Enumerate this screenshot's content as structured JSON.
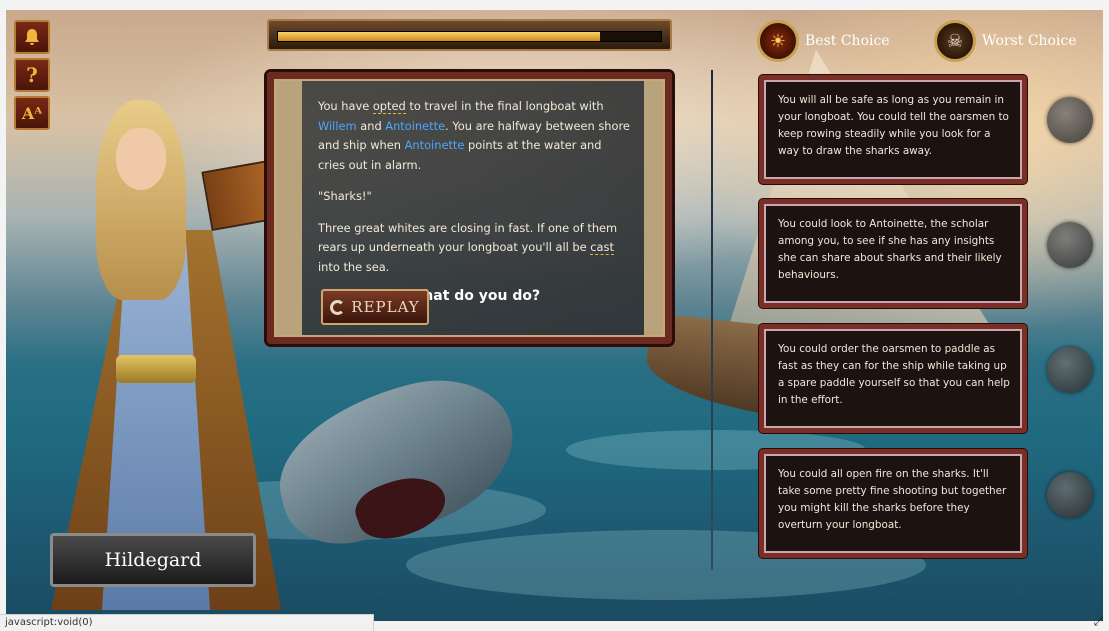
{
  "toolbar": {
    "tools": [
      {
        "icon": "bell-icon",
        "glyph": "🔔"
      },
      {
        "icon": "help-icon",
        "glyph": "?"
      },
      {
        "icon": "text-size-icon",
        "glyph": "Aᴬ"
      }
    ]
  },
  "progress": {
    "value": 0.84,
    "fill_color": "#e8b23a"
  },
  "story": {
    "p1_a": "You have ",
    "p1_opted": "opted",
    "p1_b": " to travel in the final longboat with ",
    "willem": "Willem",
    "p1_c": " and ",
    "antoinette1": "Antoinette",
    "p1_d": ". You are halfway between shore and ship when ",
    "antoinette2": "Antoinette",
    "p1_e": " points at the water and cries out in alarm.",
    "p2": "\"Sharks!\"",
    "p3_a": "Three great whites are closing in fast. If one of them rears up underneath your longboat you'll all be ",
    "p3_cast": "cast",
    "p3_b": " into the sea.",
    "question": "What do you do?",
    "replay_label": "REPLAY"
  },
  "choice_header": {
    "best_label": "Best Choice",
    "best_icon": "sunburst-medal-icon",
    "worst_label": "Worst Choice",
    "worst_icon": "skull-medal-icon"
  },
  "choices": [
    {
      "text": "You will all be safe as long as you remain in your longboat. You could tell the oarsmen to keep rowing steadily while you look for a way to draw the sharks away."
    },
    {
      "text": "You could look to Antoinette, the scholar among you, to see if she has any insights she can share about sharks and their likely behaviours."
    },
    {
      "text": "You could order the oarsmen to paddle as fast as they can for the ship while taking up a spare paddle yourself so that you can help in the effort."
    },
    {
      "text": "You could all open fire on the sharks. It'll take some pretty fine shooting but together you might kill the sharks before they overturn your longboat."
    }
  ],
  "character": {
    "name": "Hildegard"
  },
  "status_bar": {
    "text": "javascript:void(0)"
  },
  "colors": {
    "link": "#4da6ff",
    "panel_border": "#6b2a20",
    "card_border": "#7a2f26"
  }
}
